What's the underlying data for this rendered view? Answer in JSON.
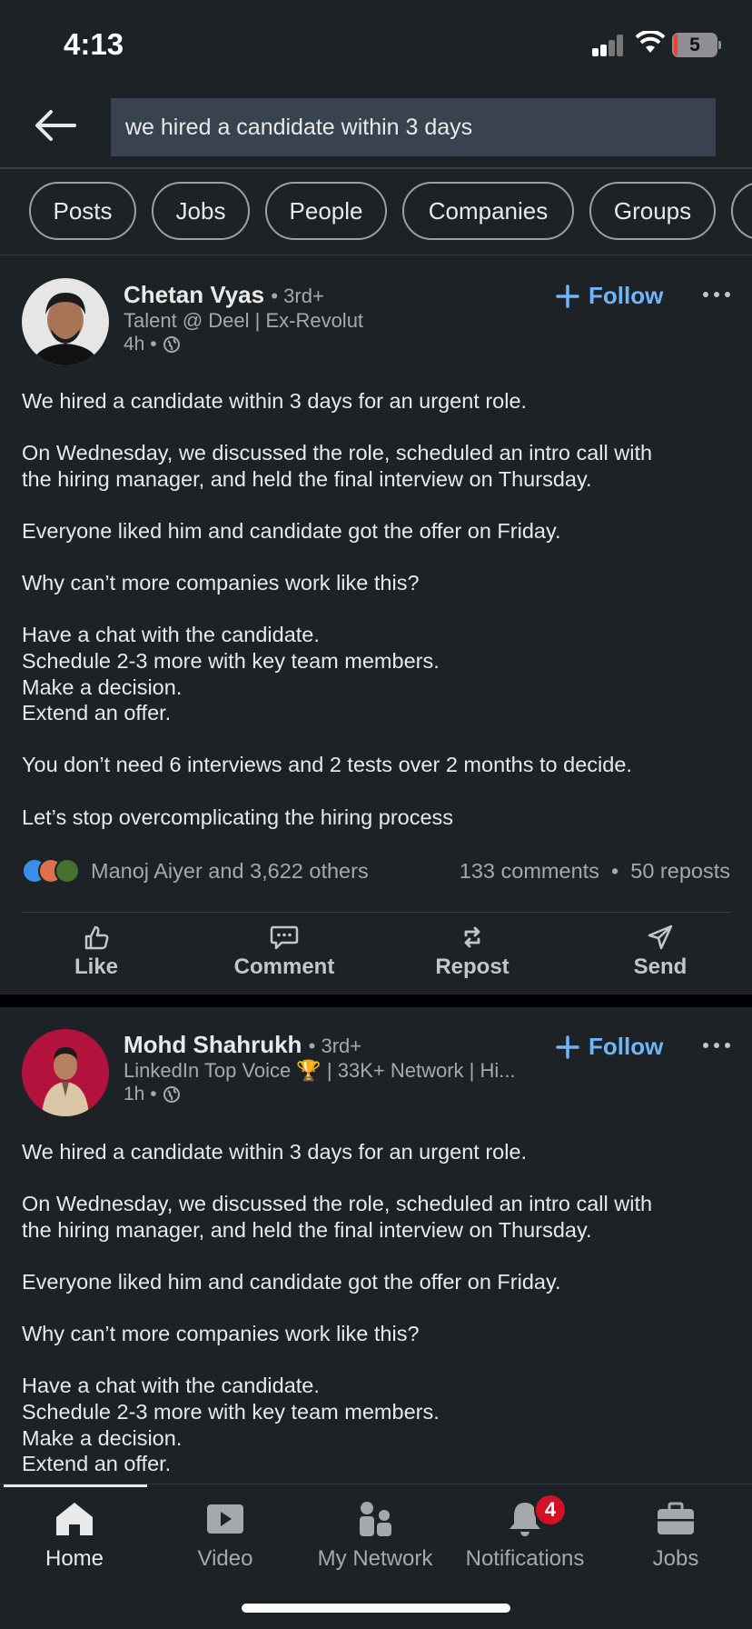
{
  "status_bar": {
    "time": "4:13",
    "battery_level": "5"
  },
  "search": {
    "query": "we hired a candidate within 3 days"
  },
  "filters": [
    "Posts",
    "Jobs",
    "People",
    "Companies",
    "Groups"
  ],
  "posts": [
    {
      "author_name": "Chetan Vyas",
      "degree": "• 3rd+",
      "headline": "Talent @ Deel | Ex-Revolut",
      "time": "4h •",
      "follow_label": "Follow",
      "body": [
        "We hired a candidate within 3 days for an urgent role.",
        "On Wednesday, we discussed the role, scheduled an intro call with\nthe hiring manager, and held the final interview on Thursday.",
        "Everyone liked him and candidate got the offer on Friday.",
        "Why can’t more companies work like this?",
        "Have a chat with the candidate.\nSchedule 2-3 more with key team members.\nMake a decision.\nExtend an offer.",
        "You don’t need 6 interviews and 2 tests over 2 months to decide.",
        "Let’s stop overcomplicating the hiring process"
      ],
      "reactions_text": "Manoj Aiyer and 3,622 others",
      "counts_text": "133 comments  •  50 reposts"
    },
    {
      "author_name": "Mohd Shahrukh",
      "degree": "• 3rd+",
      "headline": "LinkedIn Top Voice 🏆 | 33K+ Network | Hi...",
      "time": "1h •",
      "follow_label": "Follow",
      "body": [
        "We hired a candidate within 3 days for an urgent role.",
        "On Wednesday, we discussed the role, scheduled an intro call with\nthe hiring manager, and held the final interview on Thursday.",
        "Everyone liked him and candidate got the offer on Friday.",
        "Why can’t more companies work like this?",
        "Have a chat with the candidate.\nSchedule 2-3 more with key team members.\nMake a decision.\nExtend an offer."
      ]
    }
  ],
  "post_actions": [
    "Like",
    "Comment",
    "Repost",
    "Send"
  ],
  "bottom_nav": {
    "items": [
      "Home",
      "Video",
      "My Network",
      "Notifications",
      "Jobs"
    ],
    "active": "Home",
    "notifications_badge": "4"
  },
  "colors": {
    "background": "#1d2226",
    "accent": "#70b5f9",
    "badge": "#d11124"
  }
}
